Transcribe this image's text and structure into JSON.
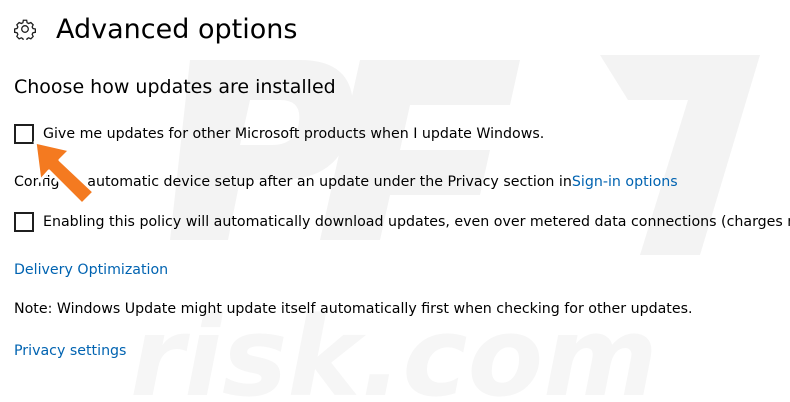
{
  "header": {
    "title": "Advanced options",
    "icon": "gear-icon"
  },
  "section": {
    "title": "Choose how updates are installed"
  },
  "options": {
    "microsoft_products_label": "Give me updates for other Microsoft products when I update Windows.",
    "microsoft_products_checked": false,
    "device_setup_text": "Configure automatic device setup after an update under the Privacy section in ",
    "sign_in_link": "Sign-in options",
    "metered_label": "Enabling this policy will automatically download updates, even over metered data connections (charges may apply)",
    "metered_checked": false
  },
  "links": {
    "delivery_optimization": "Delivery Optimization",
    "privacy_settings": "Privacy settings"
  },
  "note": "Note: Windows Update might update itself automatically first when checking for other updates.",
  "colors": {
    "link": "#0063b1",
    "arrow": "#f47a20"
  }
}
